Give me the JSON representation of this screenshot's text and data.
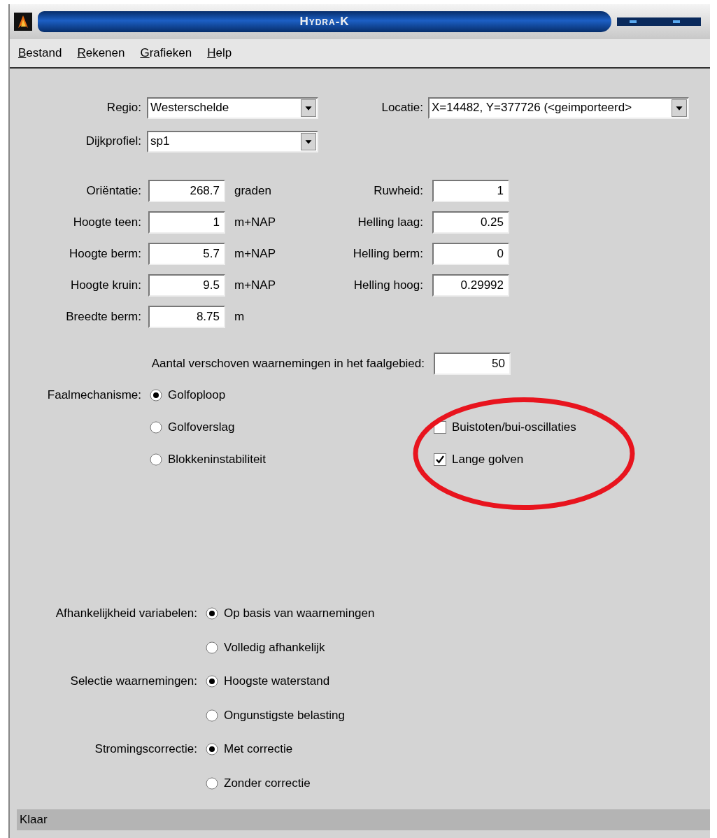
{
  "window": {
    "title": "Hydra-K"
  },
  "menu": [
    "Bestand",
    "Rekenen",
    "Grafieken",
    "Help"
  ],
  "selectors": [
    {
      "label": "Regio:",
      "value": "Westerschelde"
    },
    {
      "label": "Locatie:",
      "value": "X=14482, Y=377726 (<geimporteerd>"
    },
    {
      "label": "Dijkprofiel:",
      "value": "sp1"
    }
  ],
  "profile_fields": [
    {
      "label": "Oriëntatie:",
      "value": "268.7",
      "unit": "graden",
      "right_label": "Ruwheid:",
      "right_value": "1"
    },
    {
      "label": "Hoogte teen:",
      "value": "1",
      "unit": "m+NAP",
      "right_label": "Helling laag:",
      "right_value": "0.25"
    },
    {
      "label": "Hoogte berm:",
      "value": "5.7",
      "unit": "m+NAP",
      "right_label": "Helling berm:",
      "right_value": "0"
    },
    {
      "label": "Hoogte kruin:",
      "value": "9.5",
      "unit": "m+NAP",
      "right_label": "Helling hoog:",
      "right_value": "0.29992"
    },
    {
      "label": "Breedte berm:",
      "value": "8.75",
      "unit": "m"
    }
  ],
  "shift_count": {
    "label": "Aantal verschoven waarnemingen in het faalgebied:",
    "value": "50"
  },
  "failure_mechanism": {
    "label": "Faalmechanisme:",
    "options": [
      {
        "label": "Golfoploop",
        "selected": true
      },
      {
        "label": "Golfoverslag",
        "selected": false
      },
      {
        "label": "Blokkeninstabiliteit",
        "selected": false
      }
    ]
  },
  "checkboxes": [
    {
      "label": "Buistoten/bui-oscillaties",
      "checked": false
    },
    {
      "label": "Lange golven",
      "checked": true
    }
  ],
  "annotation": {
    "kind": "ellipse",
    "color": "#e8141e"
  },
  "option_groups": [
    {
      "label": "Afhankelijkheid variabelen:",
      "options": [
        {
          "label": "Op basis van waarnemingen",
          "selected": true
        },
        {
          "label": "Volledig afhankelijk",
          "selected": false
        }
      ]
    },
    {
      "label": "Selectie waarnemingen:",
      "options": [
        {
          "label": "Hoogste waterstand",
          "selected": true
        },
        {
          "label": "Ongunstigste belasting",
          "selected": false
        }
      ]
    },
    {
      "label": "Stromingscorrectie:",
      "options": [
        {
          "label": "Met correctie",
          "selected": true
        },
        {
          "label": "Zonder correctie",
          "selected": false
        }
      ]
    }
  ],
  "status_bar": "Klaar"
}
